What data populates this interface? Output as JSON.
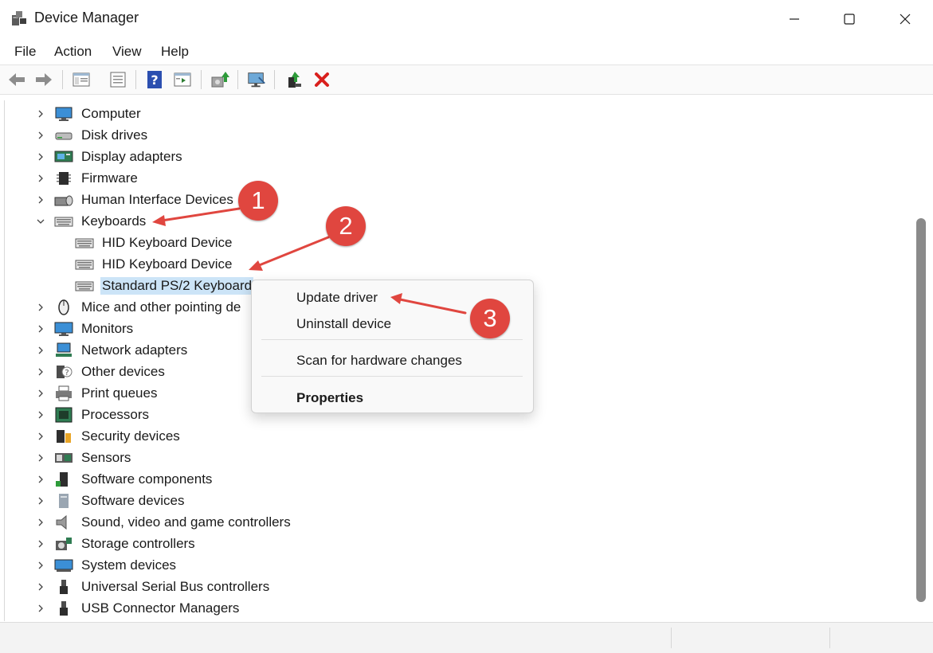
{
  "window": {
    "title": "Device Manager",
    "controls": [
      "minimize-icon",
      "maximize-icon",
      "close-icon"
    ]
  },
  "menu": [
    "File",
    "Action",
    "View",
    "Help"
  ],
  "toolbar": [
    {
      "name": "back-arrow-icon",
      "enabled": false
    },
    {
      "name": "forward-arrow-icon",
      "enabled": false
    },
    {
      "name": "show-hide-console-tree-icon"
    },
    {
      "name": "properties-icon"
    },
    {
      "name": "help-icon"
    },
    {
      "name": "show-action-pane-icon"
    },
    {
      "name": "update-driver-icon"
    },
    {
      "name": "scan-hardware-changes-icon"
    },
    {
      "name": "enable-device-icon"
    },
    {
      "name": "uninstall-device-icon"
    }
  ],
  "tree": {
    "categories": [
      {
        "label": "Computer",
        "icon": "computer-icon"
      },
      {
        "label": "Disk drives",
        "icon": "disk-drive-icon"
      },
      {
        "label": "Display adapters",
        "icon": "display-adapter-icon"
      },
      {
        "label": "Firmware",
        "icon": "firmware-icon"
      },
      {
        "label": "Human Interface Devices",
        "icon": "hid-icon"
      },
      {
        "label": "Keyboards",
        "icon": "keyboard-icon",
        "expanded": true,
        "children": [
          {
            "label": "HID Keyboard Device",
            "icon": "keyboard-icon"
          },
          {
            "label": "HID Keyboard Device",
            "icon": "keyboard-icon"
          },
          {
            "label": "Standard PS/2 Keyboard",
            "icon": "keyboard-icon",
            "selected": true
          }
        ]
      },
      {
        "label": "Mice and other pointing de",
        "icon": "mouse-icon"
      },
      {
        "label": "Monitors",
        "icon": "monitor-icon"
      },
      {
        "label": "Network adapters",
        "icon": "network-adapter-icon"
      },
      {
        "label": "Other devices",
        "icon": "other-devices-icon"
      },
      {
        "label": "Print queues",
        "icon": "printer-icon"
      },
      {
        "label": "Processors",
        "icon": "processor-icon"
      },
      {
        "label": "Security devices",
        "icon": "security-device-icon"
      },
      {
        "label": "Sensors",
        "icon": "sensor-icon"
      },
      {
        "label": "Software components",
        "icon": "software-component-icon"
      },
      {
        "label": "Software devices",
        "icon": "software-device-icon"
      },
      {
        "label": "Sound, video and game controllers",
        "icon": "speaker-icon"
      },
      {
        "label": "Storage controllers",
        "icon": "storage-controller-icon"
      },
      {
        "label": "System devices",
        "icon": "system-device-icon"
      },
      {
        "label": "Universal Serial Bus controllers",
        "icon": "usb-icon"
      },
      {
        "label": "USB Connector Managers",
        "icon": "usb-icon"
      }
    ]
  },
  "context_menu": {
    "items": [
      "Update driver",
      "Uninstall device",
      "Scan for hardware changes",
      "Properties"
    ],
    "bold_item": "Properties"
  },
  "callouts": [
    "1",
    "2",
    "3"
  ],
  "colors": {
    "selection": "#cce4f7",
    "callout": "#e0463f",
    "uninstall_x": "#d9201d"
  }
}
